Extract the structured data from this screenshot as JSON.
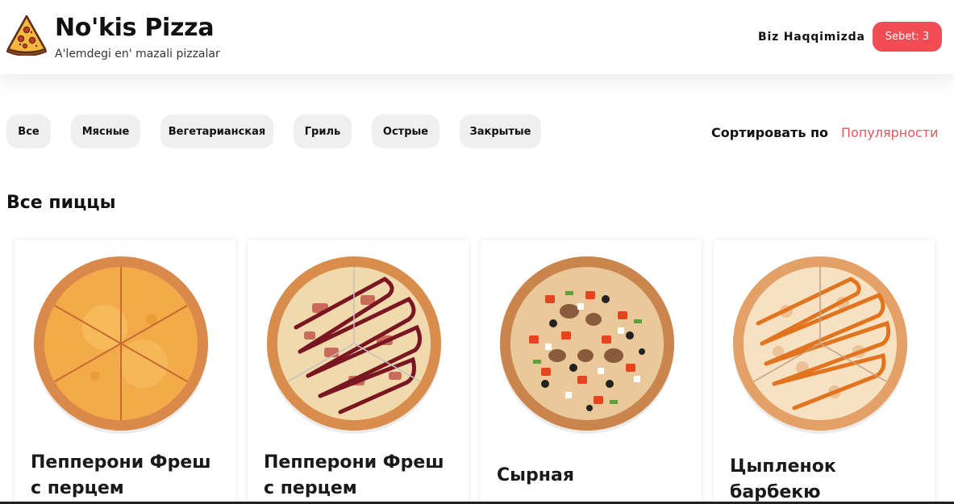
{
  "header": {
    "brand_title": "No'kis Pizza",
    "brand_subtitle": "A'lemdegi en' mazali pizzalar",
    "logo_icon": "pizza-slice-icon",
    "about_link": "Biz Haqqimizda",
    "cart_button": "Sebet: 3",
    "accent_color": "#f24c54"
  },
  "categories": [
    {
      "label": "Все",
      "active": true
    },
    {
      "label": "Мясные",
      "active": false
    },
    {
      "label": "Вегетарианская",
      "active": false
    },
    {
      "label": "Гриль",
      "active": false
    },
    {
      "label": "Острые",
      "active": false
    },
    {
      "label": "Закрытые",
      "active": false
    }
  ],
  "sort": {
    "label": "Сортировать по",
    "value": "Популярности",
    "value_color": "#e2575e"
  },
  "section_title": "Все пиццы",
  "pizzas": [
    {
      "name": "Пепперони Фреш с перцем"
    },
    {
      "name": "Пепперони Фреш с перцем"
    },
    {
      "name": "Сырная"
    },
    {
      "name": "Цыпленок барбекю"
    }
  ]
}
